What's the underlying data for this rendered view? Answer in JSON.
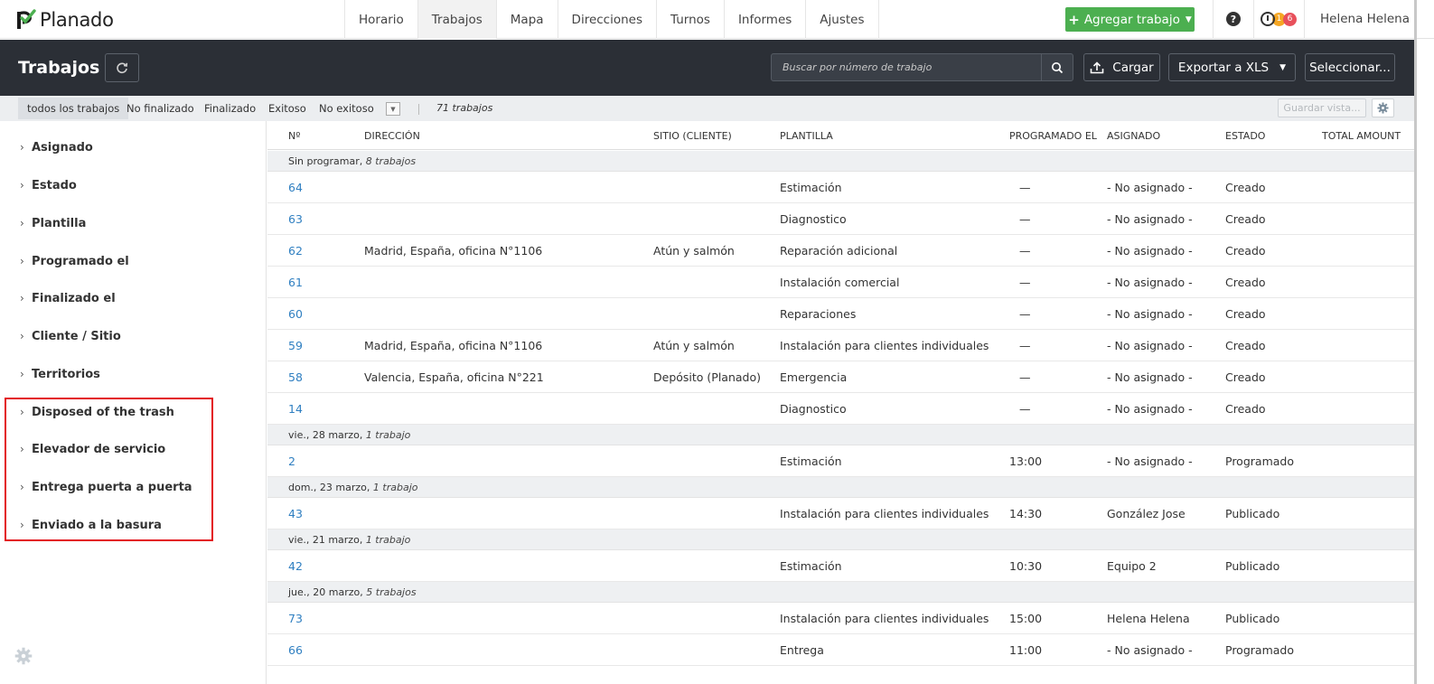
{
  "brand": {
    "name": "Planado"
  },
  "nav": {
    "tabs": [
      "Horario",
      "Trabajos",
      "Mapa",
      "Direcciones",
      "Turnos",
      "Informes",
      "Ajustes"
    ]
  },
  "top": {
    "add_label": "Agregar trabajo",
    "help": "?",
    "badge1": "1",
    "badge2": "6",
    "user": "Helena Helena"
  },
  "header": {
    "title": "Trabajos",
    "search_placeholder": "Buscar por número de trabajo",
    "upload_label": "Cargar",
    "export_label": "Exportar a XLS",
    "select_label": "Seleccionar..."
  },
  "filters": {
    "tabs": [
      "todos los trabajos",
      "No finalizado",
      "Finalizado",
      "Exitoso",
      "No exitoso"
    ],
    "count": "71 trabajos",
    "save_view": "Guardar vista..."
  },
  "sidebar": {
    "items": [
      "Asignado",
      "Estado",
      "Plantilla",
      "Programado el",
      "Finalizado el",
      "Cliente / Sitio",
      "Territorios",
      "Disposed of the trash",
      "Elevador de servicio",
      "Entrega puerta a puerta",
      "Enviado a la basura"
    ]
  },
  "table": {
    "headers": [
      "Nº",
      "DIRECCIÓN",
      "SITIO (CLIENTE)",
      "PLANTILLA",
      "PROGRAMADO EL",
      "ASIGNADO",
      "ESTADO",
      "TOTAL AMOUNT"
    ],
    "groups": [
      {
        "label": "Sin programar",
        "count": "8 trabajos",
        "rows": [
          {
            "num": "64",
            "address": "",
            "site": "",
            "template": "Estimación",
            "scheduled": "—",
            "assigned": "- No asignado -",
            "status": "Creado"
          },
          {
            "num": "63",
            "address": "",
            "site": "",
            "template": "Diagnostico",
            "scheduled": "—",
            "assigned": "- No asignado -",
            "status": "Creado"
          },
          {
            "num": "62",
            "address": "Madrid, España, oficina N°1106",
            "site": "Atún y salmón",
            "template": "Reparación adicional",
            "scheduled": "—",
            "assigned": "- No asignado -",
            "status": "Creado"
          },
          {
            "num": "61",
            "address": "",
            "site": "",
            "template": "Instalación comercial",
            "scheduled": "—",
            "assigned": "- No asignado -",
            "status": "Creado"
          },
          {
            "num": "60",
            "address": "",
            "site": "",
            "template": "Reparaciones",
            "scheduled": "—",
            "assigned": "- No asignado -",
            "status": "Creado"
          },
          {
            "num": "59",
            "address": "Madrid, España, oficina N°1106",
            "site": "Atún y salmón",
            "template": "Instalación para clientes individuales",
            "scheduled": "—",
            "assigned": "- No asignado -",
            "status": "Creado"
          },
          {
            "num": "58",
            "address": "Valencia, España, oficina N°221",
            "site": "Depósito (Planado)",
            "template": "Emergencia",
            "scheduled": "—",
            "assigned": "- No asignado -",
            "status": "Creado"
          },
          {
            "num": "14",
            "address": "",
            "site": "",
            "template": "Diagnostico",
            "scheduled": "—",
            "assigned": "- No asignado -",
            "status": "Creado"
          }
        ]
      },
      {
        "label": "vie., 28 marzo",
        "count": "1 trabajo",
        "rows": [
          {
            "num": "2",
            "address": "",
            "site": "",
            "template": "Estimación",
            "scheduled": "13:00",
            "assigned": "- No asignado -",
            "status": "Programado"
          }
        ]
      },
      {
        "label": "dom., 23 marzo",
        "count": "1 trabajo",
        "rows": [
          {
            "num": "43",
            "address": "",
            "site": "",
            "template": "Instalación para clientes individuales",
            "scheduled": "14:30",
            "assigned": "González Jose",
            "status": "Publicado"
          }
        ]
      },
      {
        "label": "vie., 21 marzo",
        "count": "1 trabajo",
        "rows": [
          {
            "num": "42",
            "address": "",
            "site": "",
            "template": "Estimación",
            "scheduled": "10:30",
            "assigned": "Equipo 2",
            "status": "Publicado"
          }
        ]
      },
      {
        "label": "jue., 20 marzo",
        "count": "5 trabajos",
        "rows": [
          {
            "num": "73",
            "address": "",
            "site": "",
            "template": "Instalación para clientes individuales",
            "scheduled": "15:00",
            "assigned": "Helena Helena",
            "status": "Publicado"
          },
          {
            "num": "66",
            "address": "",
            "site": "",
            "template": "Entrega",
            "scheduled": "11:00",
            "assigned": "- No asignado -",
            "status": "Programado"
          }
        ]
      }
    ]
  },
  "colors": {
    "accent_green": "#4caf50",
    "header_dark": "#2b2f36",
    "link_blue": "#2f7fc1",
    "highlight_red": "#e3141b"
  }
}
